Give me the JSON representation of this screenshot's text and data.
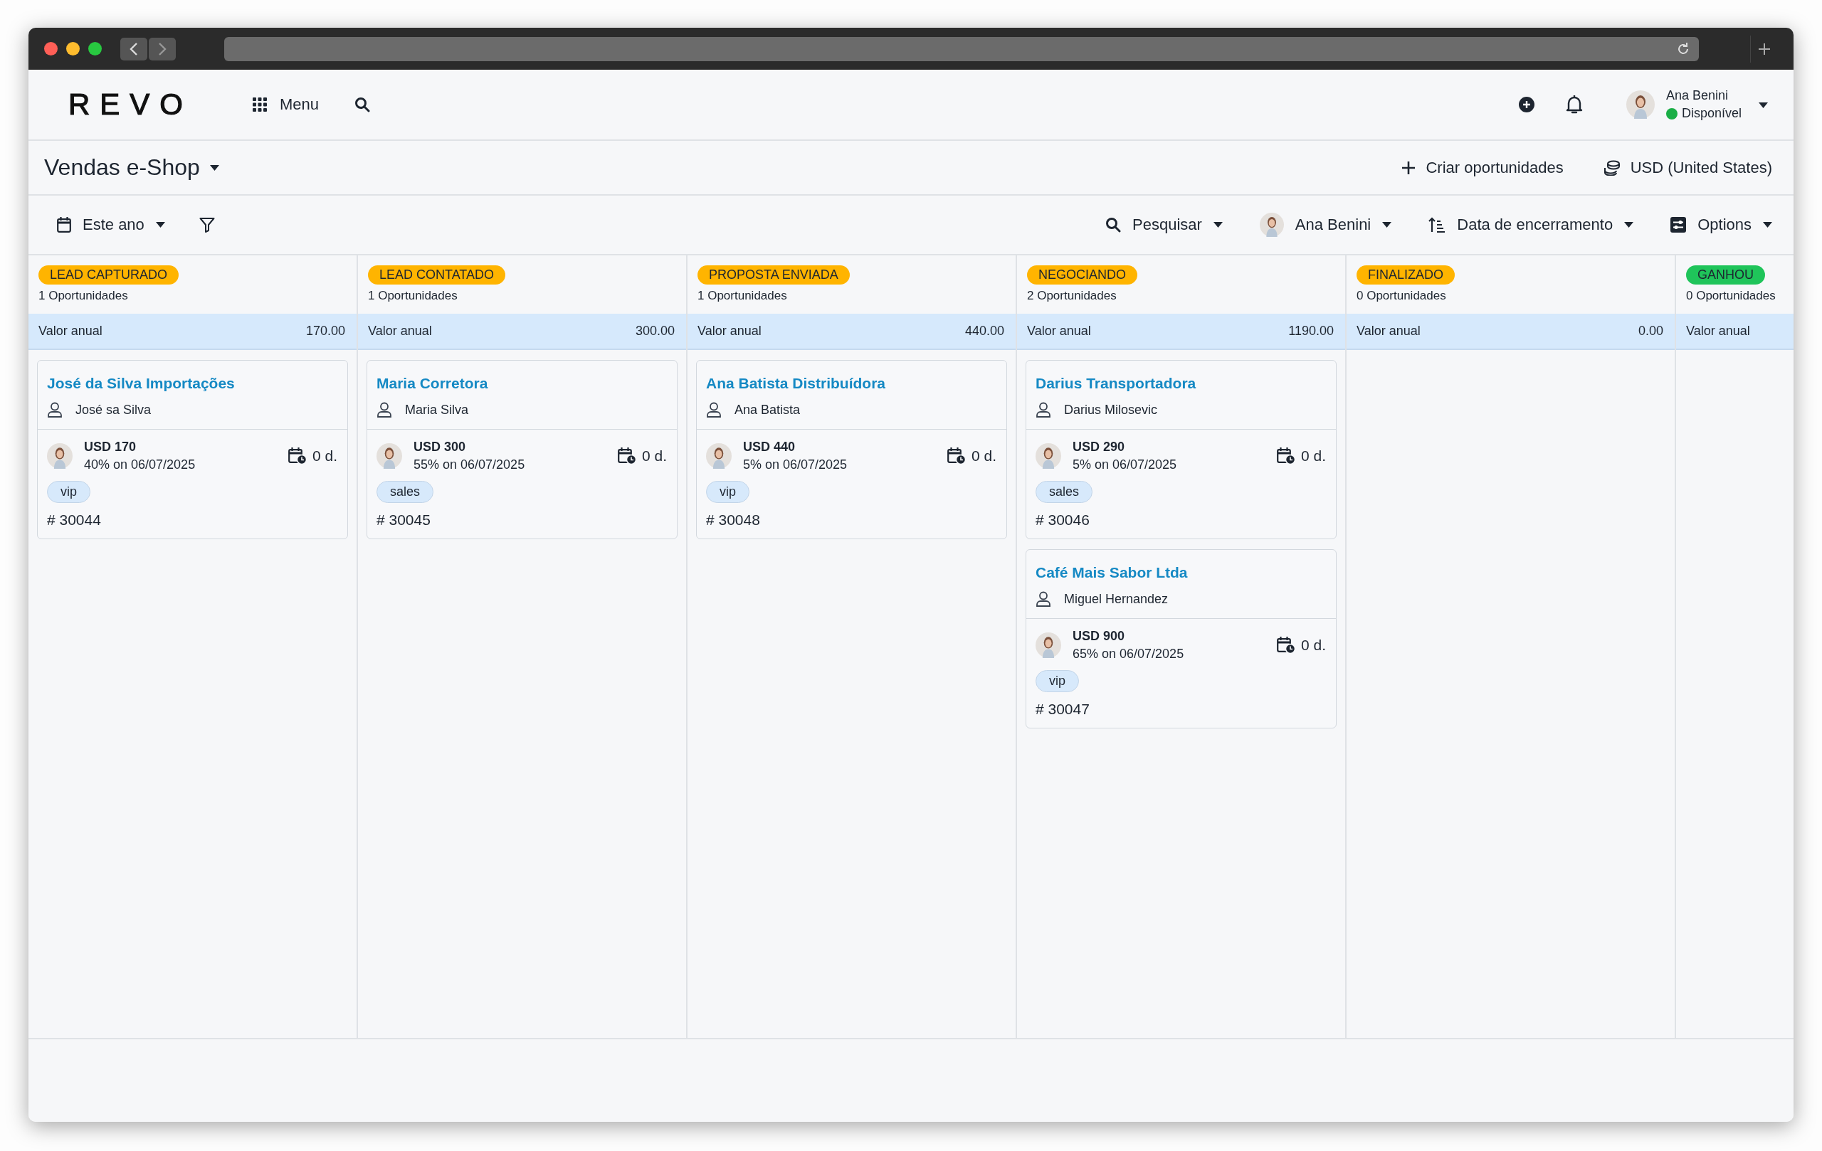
{
  "header": {
    "logo": "REVO",
    "menu_label": "Menu",
    "user": {
      "name": "Ana Benini",
      "status": "Disponível"
    }
  },
  "page": {
    "title": "Vendas e-Shop",
    "actions": [
      {
        "kind": "create",
        "label": "Criar oportunidades"
      },
      {
        "kind": "currency",
        "label": "USD (United States)"
      }
    ]
  },
  "toolbar": {
    "left": [
      {
        "kind": "calendar",
        "label": "Este ano"
      },
      {
        "kind": "filter"
      }
    ],
    "right": [
      {
        "kind": "search",
        "label": "Pesquisar"
      },
      {
        "kind": "avatar",
        "label": "Ana Benini"
      },
      {
        "kind": "sort",
        "label": "Data de encerramento"
      },
      {
        "kind": "options",
        "label": "Options"
      }
    ]
  },
  "columns": [
    {
      "stage": "LEAD CAPTURADO",
      "color": "#ffb400",
      "count": "1 Oportunidades",
      "sum_label": "Valor anual",
      "sum": "170.00",
      "cards": [
        {
          "title": "José da Silva Importações",
          "contact": "José sa Silva",
          "amount": "USD 170",
          "forecast": "40% on 06/07/2025",
          "days": "0 d.",
          "tag": "vip",
          "number": "# 30044"
        }
      ]
    },
    {
      "stage": "LEAD CONTATADO",
      "color": "#ffb400",
      "count": "1 Oportunidades",
      "sum_label": "Valor anual",
      "sum": "300.00",
      "cards": [
        {
          "title": "Maria Corretora",
          "contact": "Maria Silva",
          "amount": "USD 300",
          "forecast": "55% on 06/07/2025",
          "days": "0 d.",
          "tag": "sales",
          "number": "# 30045"
        }
      ]
    },
    {
      "stage": "PROPOSTA ENVIADA",
      "color": "#ffb400",
      "count": "1 Oportunidades",
      "sum_label": "Valor anual",
      "sum": "440.00",
      "cards": [
        {
          "title": "Ana Batista Distribuídora",
          "contact": "Ana Batista",
          "amount": "USD 440",
          "forecast": "5% on 06/07/2025",
          "days": "0 d.",
          "tag": "vip",
          "number": "# 30048"
        }
      ]
    },
    {
      "stage": "NEGOCIANDO",
      "color": "#ffb400",
      "count": "2 Oportunidades",
      "sum_label": "Valor anual",
      "sum": "1190.00",
      "cards": [
        {
          "title": "Darius Transportadora",
          "contact": "Darius Milosevic",
          "amount": "USD 290",
          "forecast": "5% on 06/07/2025",
          "days": "0 d.",
          "tag": "sales",
          "number": "# 30046"
        },
        {
          "title": "Café Mais Sabor Ltda",
          "contact": "Miguel Hernandez",
          "amount": "USD 900",
          "forecast": "65% on 06/07/2025",
          "days": "0 d.",
          "tag": "vip",
          "number": "# 30047"
        }
      ]
    },
    {
      "stage": "FINALIZADO",
      "color": "#ffb400",
      "count": "0 Oportunidades",
      "sum_label": "Valor anual",
      "sum": "0.00"
    },
    {
      "stage": "GANHOU",
      "color": "#1fc45a",
      "count": "0 Oportunidades",
      "sum_label": "Valor anual"
    }
  ]
}
